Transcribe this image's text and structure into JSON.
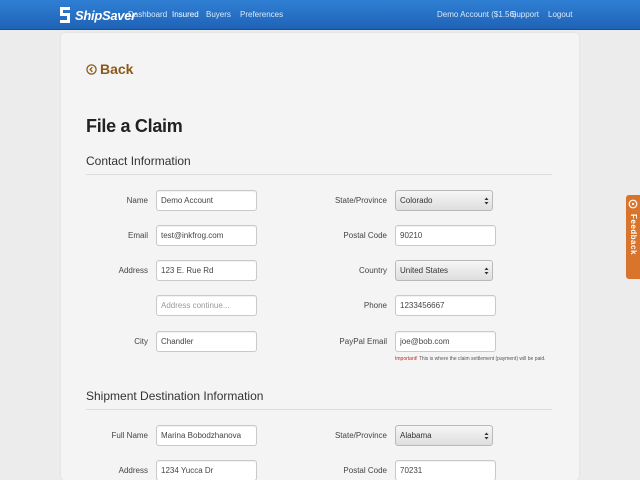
{
  "header": {
    "brand": "ShipSaver",
    "nav": [
      "Dashboard",
      "Insured",
      "Buyers",
      "Preferences"
    ],
    "active_nav": "Insured",
    "account": "Demo Account ($1.56)",
    "support": "Support",
    "logout": "Logout"
  },
  "back_label": "Back",
  "page_title": "File a Claim",
  "contact": {
    "section_title": "Contact Information",
    "name_label": "Name",
    "name_value": "Demo Account",
    "email_label": "Email",
    "email_value": "test@inkfrog.com",
    "address_label": "Address",
    "address_value": "123 E. Rue Rd",
    "address2_placeholder": "Address continue...",
    "city_label": "City",
    "city_value": "Chandler",
    "state_label": "State/Province",
    "state_value": "Colorado",
    "postal_label": "Postal Code",
    "postal_value": "90210",
    "country_label": "Country",
    "country_value": "United States",
    "phone_label": "Phone",
    "phone_value": "1233456667",
    "paypal_label": "PayPal Email",
    "paypal_value": "joe@bob.com",
    "paypal_hint_important": "Important!",
    "paypal_hint_text": " This is where the claim settlement (payment) will be paid."
  },
  "shipment": {
    "section_title": "Shipment Destination Information",
    "fullname_label": "Full Name",
    "fullname_value": "Marina Bobodzhanova",
    "address_label": "Address",
    "address_value": "1234 Yucca Dr",
    "state_label": "State/Province",
    "state_value": "Alabama",
    "postal_label": "Postal Code",
    "postal_value": "70231"
  },
  "feedback_label": "Feedback",
  "colors": {
    "navbar": "#2f7fd4",
    "back_link": "#8a5a1c",
    "feedback_tab": "#d9742d",
    "important": "#cc2222"
  },
  "icons": [
    "shipsaver-logo-icon",
    "back-circle-icon",
    "select-caret-icon",
    "feedback-icon"
  ]
}
